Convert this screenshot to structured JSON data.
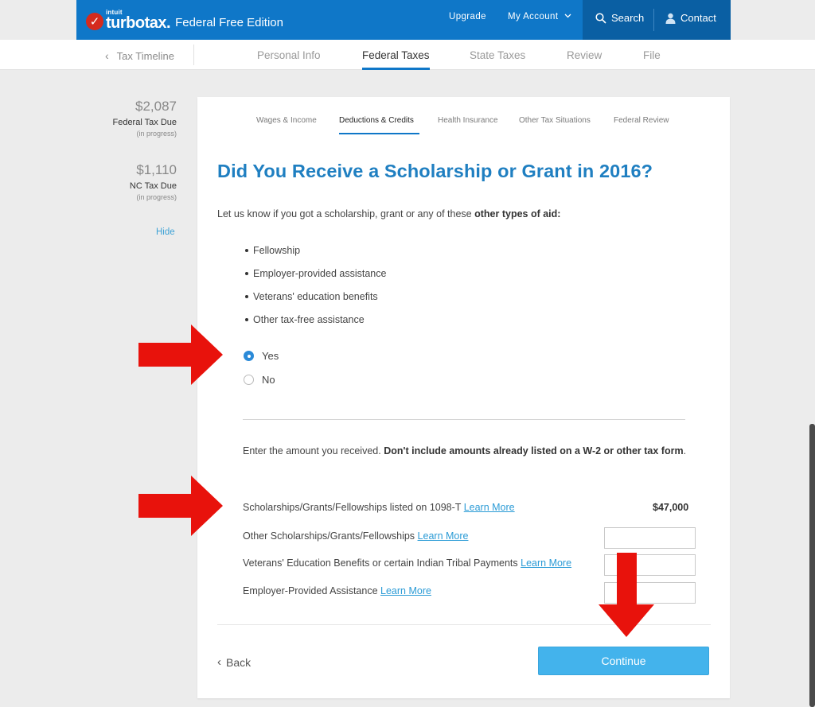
{
  "header": {
    "logo_intuit": "intuit",
    "logo_brand": "turbotax.",
    "edition": "Federal Free Edition",
    "upgrade": "Upgrade",
    "my_account": "My Account",
    "search": "Search",
    "contact": "Contact"
  },
  "subnav": {
    "timeline": "Tax Timeline",
    "tabs": [
      "Personal Info",
      "Federal Taxes",
      "State Taxes",
      "Review",
      "File"
    ],
    "active_tab": "Federal Taxes"
  },
  "summary": {
    "federal_amount": "$2,087",
    "federal_label": "Federal Tax Due",
    "federal_note": "(in progress)",
    "state_amount": "$1,110",
    "state_label": "NC Tax Due",
    "state_note": "(in progress)",
    "hide": "Hide"
  },
  "card": {
    "subtabs": [
      "Wages & Income",
      "Deductions & Credits",
      "Health Insurance",
      "Other Tax Situations",
      "Federal Review"
    ],
    "active_subtab": "Deductions & Credits",
    "headline": "Did You Receive a Scholarship or Grant in 2016?",
    "intro_text": "Let us know if you got a scholarship, grant or any of these ",
    "intro_bold": "other types of aid:",
    "bullets": [
      "Fellowship",
      "Employer-provided assistance",
      "Veterans' education benefits",
      "Other tax-free assistance"
    ],
    "radio_yes": "Yes",
    "radio_no": "No",
    "selected": "Yes",
    "enter_text": "Enter the amount you received. ",
    "enter_bold": "Don't include amounts already listed on a W-2 or other tax form",
    "enter_end": ".",
    "fields": [
      {
        "label": "Scholarships/Grants/Fellowships listed on 1098-T",
        "link": "Learn More",
        "value": "$47,000"
      },
      {
        "label": "Other Scholarships/Grants/Fellowships",
        "link": "Learn More",
        "value": ""
      },
      {
        "label": "Veterans' Education Benefits or certain Indian Tribal Payments",
        "link": "Learn More",
        "value": ""
      },
      {
        "label": "Employer-Provided Assistance",
        "link": "Learn More",
        "value": ""
      }
    ],
    "back": "Back",
    "continue": "Continue"
  },
  "colors": {
    "brand_blue": "#0f77c8",
    "accent_blue": "#43b3ec",
    "annotation_red": "#e8120c"
  }
}
